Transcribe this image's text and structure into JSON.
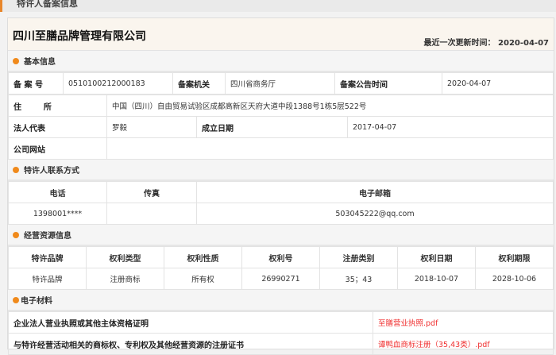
{
  "tab_title": "特许人备案信息",
  "company": "四川至膳品牌管理有限公司",
  "updated_label": "最近一次更新时间：",
  "updated_value": "2020-04-07",
  "basic": {
    "title": "基本信息",
    "record_no_label": "备 案 号",
    "record_no": "0510100212000183",
    "authority_label": "备案机关",
    "authority": "四川省商务厅",
    "notice_time_label": "备案公告时间",
    "notice_time": "2020-04-07",
    "address_label": "住        所",
    "address": "中国（四川）自由贸易试验区成都高新区天府大道中段1388号1栋5层522号",
    "legal_rep_label": "法人代表",
    "legal_rep": "罗毅",
    "founded_label": "成立日期",
    "founded": "2017-04-07",
    "website_label": "公司网站",
    "website": ""
  },
  "contact": {
    "title": "特许人联系方式",
    "headers": [
      "电话",
      "传真",
      "电子邮箱"
    ],
    "values": [
      "1398001****",
      "",
      "503045222@qq.com"
    ]
  },
  "resources": {
    "title": "经营资源信息",
    "headers": [
      "特许品牌",
      "权利类型",
      "权利性质",
      "权利号",
      "注册类别",
      "权利日期",
      "权利期限"
    ],
    "rows": [
      [
        "特许品牌",
        "注册商标",
        "所有权",
        "26990271",
        "35；43",
        "2018-10-07",
        "2028-10-06"
      ]
    ]
  },
  "materials": {
    "title": "电子材料",
    "rows": [
      {
        "label": "企业法人营业执照或其他主体资格证明",
        "file": "至膳营业执照.pdf"
      },
      {
        "label": "与特许经营活动相关的商标权、专利权及其他经营资源的注册证书",
        "file": "谭鸭血商标注册（35,43类）.pdf"
      }
    ]
  },
  "colors": {
    "accent": "#f08a1c",
    "link": "#f03030"
  }
}
